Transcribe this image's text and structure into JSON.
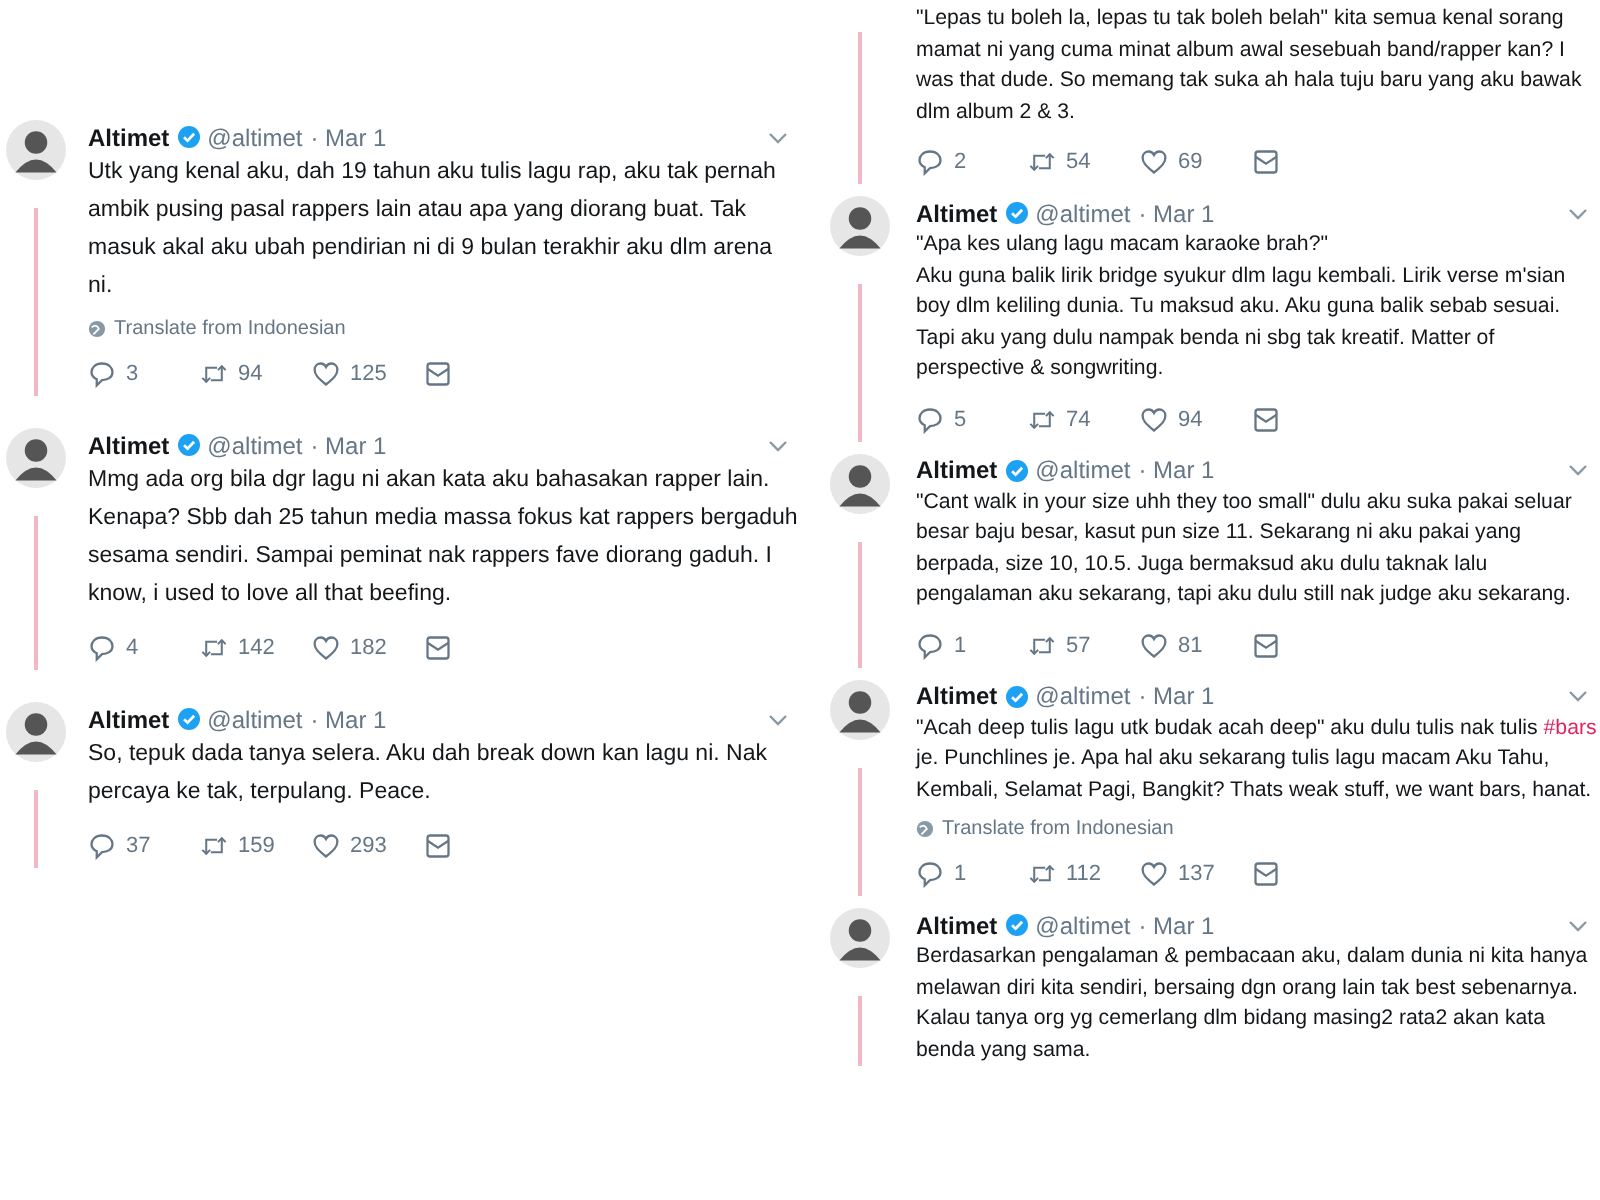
{
  "columns": [
    {
      "tweets": [
        {
          "author": "Altimet",
          "verified": true,
          "handle": "@altimet",
          "date": "· Mar 1",
          "paragraphs": [
            [
              {
                "kind": "plain",
                "text": "Utk yang kenal aku, dah 19 tahun aku tulis lagu rap, aku tak pernah ambik pusing pasal rappers lain atau apa yang diorang buat. Tak masuk akal aku ubah pendirian ni di 9 bulan terakhir aku dlm arena ni."
              }
            ]
          ],
          "translate": "Translate from Indonesian",
          "replies": "3",
          "retweets": "94",
          "likes": "125"
        },
        {
          "author": "Altimet",
          "verified": true,
          "handle": "@altimet",
          "date": "· Mar 1",
          "paragraphs": [
            [
              {
                "kind": "plain",
                "text": "Mmg ada org bila dgr lagu ni akan kata aku bahasakan rapper lain. Kenapa? Sbb dah 25 tahun media massa fokus kat rappers bergaduh sesama sendiri. Sampai peminat nak rappers fave diorang gaduh. I know, i used to love all that beefing."
              }
            ]
          ],
          "replies": "4",
          "retweets": "142",
          "likes": "182"
        },
        {
          "author": "Altimet",
          "verified": true,
          "handle": "@altimet",
          "date": "· Mar 1",
          "paragraphs": [
            [
              {
                "kind": "plain",
                "text": "So, tepuk dada tanya selera. Aku dah break down kan lagu ni. Nak percaya ke tak, terpulang. Peace."
              }
            ]
          ],
          "replies": "37",
          "retweets": "159",
          "likes": "293"
        }
      ]
    },
    {
      "tweets": [
        {
          "paragraphs": [
            [
              {
                "kind": "plain",
                "text": "\"Lepas tu boleh la, lepas tu tak boleh belah\" kita semua kenal sorang mamat ni yang cuma minat album awal sesebuah band/rapper kan? I was that dude. So memang tak suka ah hala tuju baru yang aku bawak dlm album 2 & 3."
              }
            ]
          ],
          "replies": "2",
          "retweets": "54",
          "likes": "69"
        },
        {
          "author": "Altimet",
          "verified": true,
          "handle": "@altimet",
          "date": "· Mar 1",
          "paragraphs": [
            [
              {
                "kind": "plain",
                "text": "\"Apa kes ulang lagu macam karaoke brah?\""
              }
            ],
            [
              {
                "kind": "plain",
                "text": "Aku guna balik lirik bridge syukur dlm lagu kembali. Lirik verse m'sian boy dlm keliling dunia. Tu maksud aku. Aku guna balik sebab sesuai. Tapi aku yang dulu nampak benda ni sbg tak kreatif. Matter of perspective & songwriting."
              }
            ]
          ],
          "replies": "5",
          "retweets": "74",
          "likes": "94"
        },
        {
          "author": "Altimet",
          "verified": true,
          "handle": "@altimet",
          "date": "· Mar 1",
          "paragraphs": [
            [
              {
                "kind": "plain",
                "text": "\"Cant walk in your size uhh they too small\" dulu aku suka pakai seluar besar baju besar, kasut pun size 11. Sekarang ni aku pakai yang berpada, size 10, 10.5. Juga bermaksud aku dulu taknak lalu pengalaman aku sekarang, tapi aku dulu still nak judge aku sekarang."
              }
            ]
          ],
          "replies": "1",
          "retweets": "57",
          "likes": "81"
        },
        {
          "author": "Altimet",
          "verified": true,
          "handle": "@altimet",
          "date": "· Mar 1",
          "paragraphs": [
            [
              {
                "kind": "plain",
                "text": "\"Acah deep tulis lagu utk budak acah deep\" aku dulu tulis nak tulis "
              },
              {
                "kind": "hashtag",
                "text": "#bars"
              },
              {
                "kind": "plain",
                "text": " je. Punchlines je. Apa hal aku sekarang tulis lagu macam Aku Tahu, Kembali, Selamat Pagi, Bangkit? Thats weak stuff, we want bars, hanat."
              }
            ]
          ],
          "translate": "Translate from Indonesian",
          "replies": "1",
          "retweets": "112",
          "likes": "137"
        },
        {
          "author": "Altimet",
          "verified": true,
          "handle": "@altimet",
          "date": "· Mar 1",
          "paragraphs": [
            [
              {
                "kind": "plain",
                "text": "Berdasarkan pengalaman & pembacaan aku, dalam dunia ni kita hanya melawan diri kita sendiri, bersaing dgn orang lain tak best sebenarnya. Kalau tanya org yg cemerlang dlm bidang masing2 rata2 akan kata benda yang sama."
              }
            ]
          ]
        }
      ]
    }
  ]
}
